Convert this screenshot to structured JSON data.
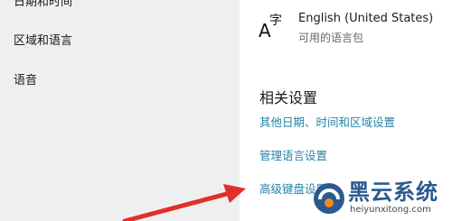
{
  "nav": {
    "items": [
      {
        "label": "日期和时间"
      },
      {
        "label": "区域和语言"
      },
      {
        "label": "语音"
      }
    ]
  },
  "language": {
    "icon": "language-icon",
    "name": "English (United States)",
    "status": "可用的语言包"
  },
  "related": {
    "heading": "相关设置",
    "links": [
      {
        "label": "其他日期、时间和区域设置"
      },
      {
        "label": "管理语言设置"
      },
      {
        "label": "高级键盘设置"
      }
    ]
  },
  "annotation": {
    "arrow_color": "#e0302a"
  },
  "watermark": {
    "title": "黑云系统",
    "url": "heiyunxitong.com",
    "color": "#2a5a8f",
    "accent": "#f28a1f"
  },
  "colors": {
    "link": "#2683a8",
    "nav_background": "#f0eff0"
  }
}
